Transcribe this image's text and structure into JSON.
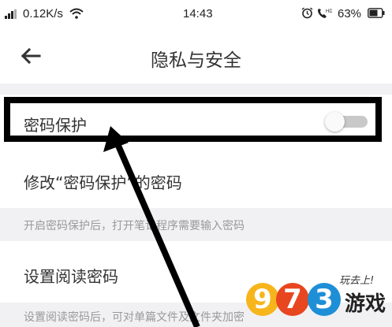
{
  "status_bar": {
    "network_speed": "0.12K/s",
    "time": "14:43",
    "battery_percent": "63%",
    "icons": [
      "signal-icon",
      "wifi-icon",
      "alarm-icon",
      "hd-call-icon",
      "battery-icon"
    ]
  },
  "header": {
    "back_icon": "back-arrow-icon",
    "title": "隐私与安全"
  },
  "settings": {
    "password_protect": {
      "label": "密码保护",
      "toggle_on": false
    },
    "change_password": {
      "label": "修改“密码保护”的密码"
    },
    "hint_1": "开启密码保护后，打开笔记程序需要输入密码",
    "reading_password": {
      "label": "设置阅读密码"
    },
    "hint_2": "设置阅读密码后，可对单篇文件及文件夹加密"
  },
  "annotation": {
    "highlight_color": "#000000"
  },
  "watermark": {
    "digits": [
      "9",
      "7",
      "3"
    ],
    "text": "游戏",
    "script": "玩去上!",
    "colors": [
      "#f7b51c",
      "#e8461f",
      "#1e8fd6"
    ]
  },
  "colors": {
    "background": "#ffffff",
    "section_gray": "#f1f1f4",
    "text_primary": "#333333",
    "text_hint": "#999999",
    "toggle_track": "#c8c8c8"
  }
}
